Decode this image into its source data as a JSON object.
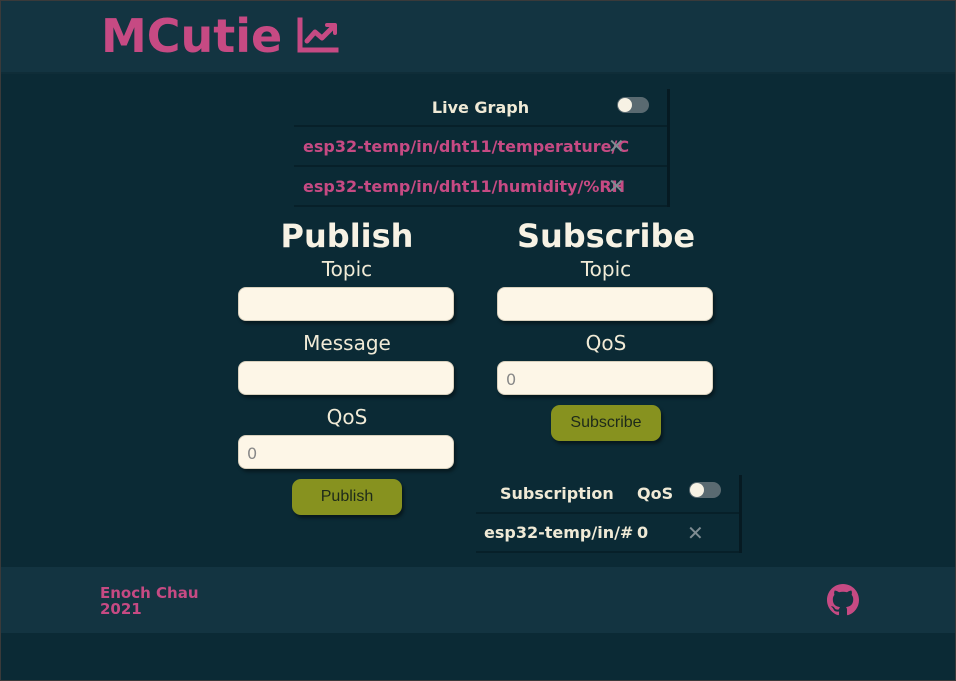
{
  "app": {
    "title": "MCutie",
    "logo_icon": "chart-line-icon",
    "accent": "#c64a83"
  },
  "live_graph": {
    "label": "Live Graph",
    "toggle_on": false,
    "topics": [
      {
        "name": "esp32-temp/in/dht11/temperature/C"
      },
      {
        "name": "esp32-temp/in/dht11/humidity/%RH"
      }
    ]
  },
  "publish": {
    "heading": "Publish",
    "topic_label": "Topic",
    "topic_value": "",
    "message_label": "Message",
    "message_value": "",
    "qos_label": "QoS",
    "qos_placeholder": "0",
    "button_label": "Publish"
  },
  "subscribe": {
    "heading": "Subscribe",
    "topic_label": "Topic",
    "topic_value": "",
    "qos_label": "QoS",
    "qos_placeholder": "0",
    "button_label": "Subscribe"
  },
  "subscriptions": {
    "headers": {
      "subscription": "Subscription",
      "qos": "QoS"
    },
    "toggle_on": false,
    "rows": [
      {
        "topic": "esp32-temp/in/#",
        "qos": "0"
      }
    ]
  },
  "footer": {
    "author": "Enoch Chau",
    "year": "2021",
    "icon": "github-icon"
  }
}
